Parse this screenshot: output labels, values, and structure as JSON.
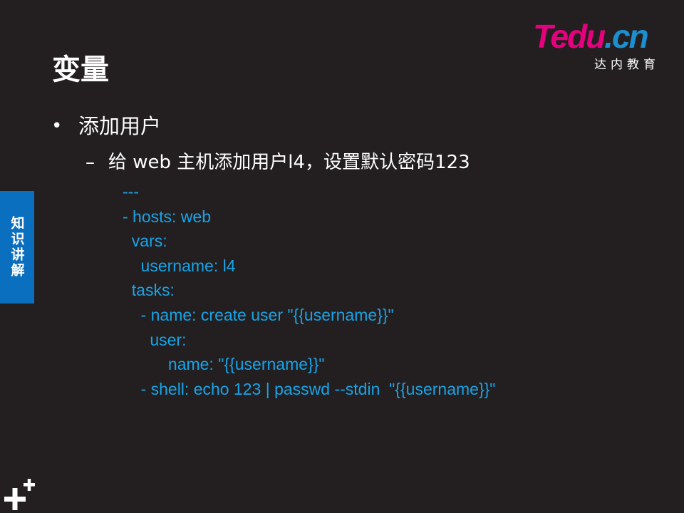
{
  "logo": {
    "brand_main": "Tedu",
    "brand_suffix": ".cn",
    "subtitle": "达内教育"
  },
  "slide": {
    "title": "变量",
    "bullet": "添加用户",
    "sub_bullet": "给 web 主机添加用户l4，设置默认密码123",
    "code_lines": [
      "---",
      "- hosts: web",
      "  vars:",
      "    username: l4",
      "  tasks:",
      "    - name: create user \"{{username}}\"",
      "      user:",
      "          name: \"{{username}}\"",
      "    - shell: echo 123 | passwd --stdin  \"{{username}}\""
    ]
  },
  "side_tab": {
    "label": "知识讲解"
  },
  "colors": {
    "background": "#231f20",
    "code": "#17a4e8",
    "tab": "#0b6fc0",
    "brand_pink": "#e6007e",
    "brand_blue": "#1b8fd0"
  },
  "icons": {
    "corner": "plus-icon"
  }
}
